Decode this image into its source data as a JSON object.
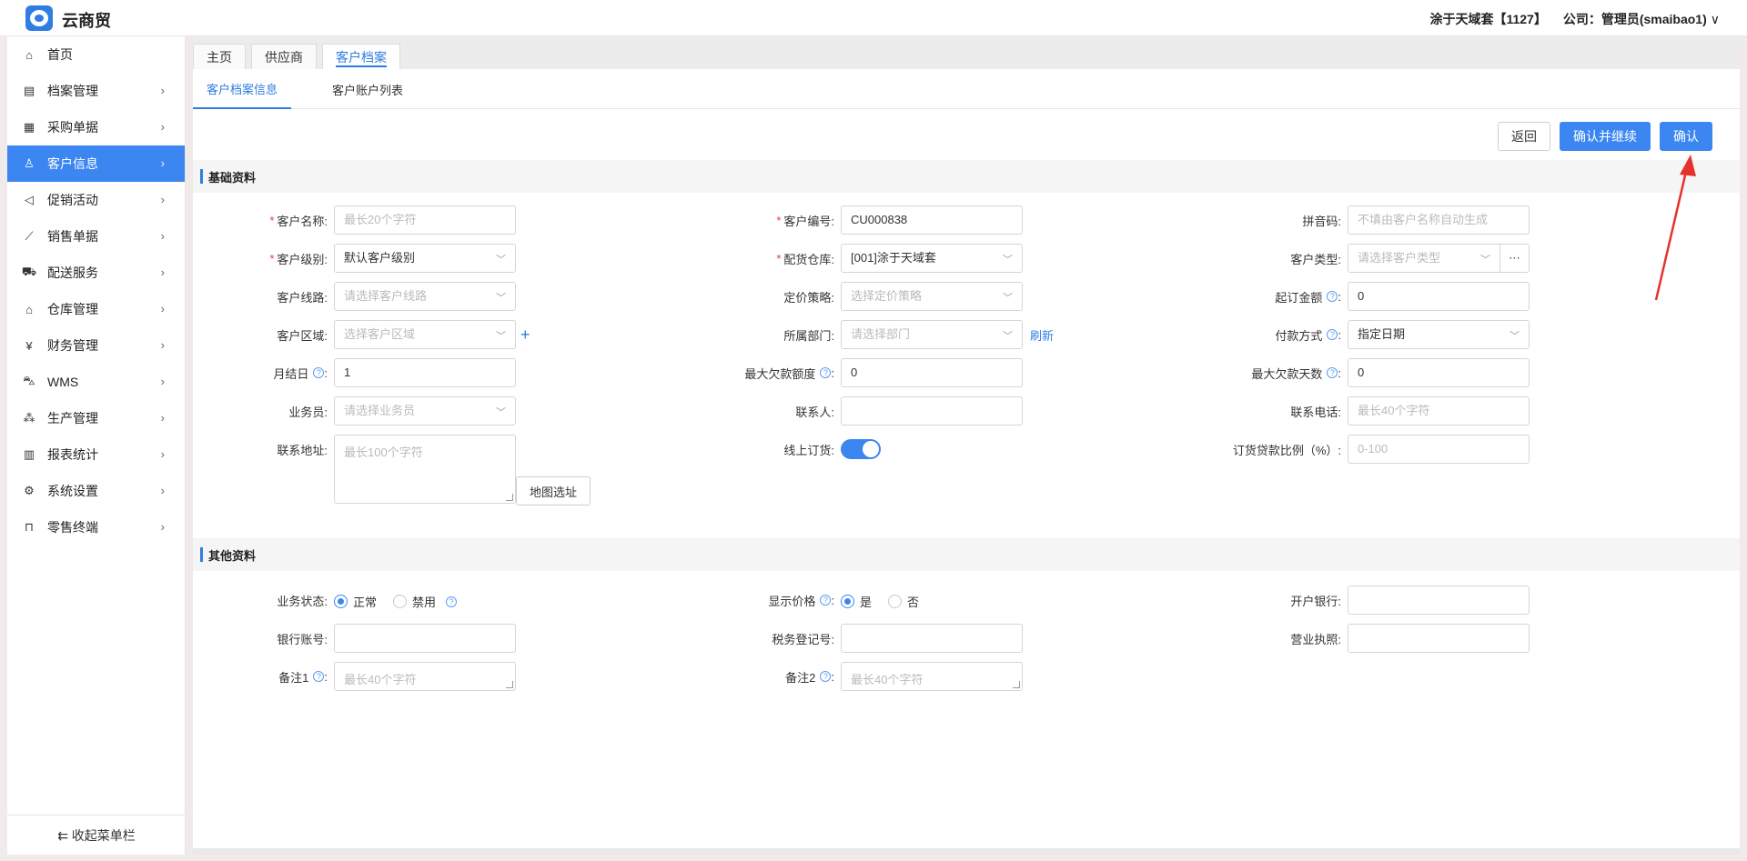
{
  "app": {
    "title": "云商贸"
  },
  "top_right": {
    "store": "涂于天域套【1127】",
    "company": "公司：管理员(smaibao1)"
  },
  "sidebar": {
    "items": [
      {
        "label": "首页",
        "icon": "home-icon",
        "glyph": "⌂"
      },
      {
        "label": "档案管理",
        "icon": "archive-icon",
        "glyph": "▤"
      },
      {
        "label": "采购单据",
        "icon": "purchase-doc-icon",
        "glyph": "▦"
      },
      {
        "label": "客户信息",
        "icon": "user-icon",
        "glyph": "♙"
      },
      {
        "label": "促销活动",
        "icon": "megaphone-icon",
        "glyph": "◁"
      },
      {
        "label": "销售单据",
        "icon": "chart-line-icon",
        "glyph": "⟋"
      },
      {
        "label": "配送服务",
        "icon": "cart-icon",
        "glyph": "⛟"
      },
      {
        "label": "仓库管理",
        "icon": "warehouse-icon",
        "glyph": "⌂"
      },
      {
        "label": "财务管理",
        "icon": "finance-icon",
        "glyph": "¥"
      },
      {
        "label": "WMS",
        "icon": "truck-icon",
        "glyph": "⛍"
      },
      {
        "label": "生产管理",
        "icon": "network-icon",
        "glyph": "⁂"
      },
      {
        "label": "报表统计",
        "icon": "bar-chart-icon",
        "glyph": "▥"
      },
      {
        "label": "系统设置",
        "icon": "gear-icon",
        "glyph": "⚙"
      },
      {
        "label": "零售终端",
        "icon": "bag-icon",
        "glyph": "⊓"
      }
    ],
    "collapse": "⇇ 收起菜单栏"
  },
  "page_tabs": [
    "主页",
    "供应商",
    "客户档案"
  ],
  "sub_tabs": [
    "客户档案信息",
    "客户账户列表"
  ],
  "actions": {
    "back": "返回",
    "confirm_continue": "确认并继续",
    "confirm": "确认"
  },
  "sections": {
    "basic": "基础资料",
    "other": "其他资料"
  },
  "basic": {
    "customer_name": {
      "label": "客户名称:",
      "placeholder": "最长20个字符"
    },
    "customer_code": {
      "label": "客户编号:",
      "value": "CU000838"
    },
    "pinyin": {
      "label": "拼音码:",
      "placeholder": "不填由客户名称自动生成"
    },
    "customer_level": {
      "label": "客户级别:",
      "value": "默认客户级别"
    },
    "warehouse": {
      "label": "配货仓库:",
      "value": "[001]涂于天域套"
    },
    "customer_type": {
      "label": "客户类型:",
      "placeholder": "请选择客户类型"
    },
    "route": {
      "label": "客户线路:",
      "placeholder": "请选择客户线路"
    },
    "pricing": {
      "label": "定价策略:",
      "placeholder": "选择定价策略"
    },
    "min_order": {
      "label": "起订金额",
      "value": "0"
    },
    "region": {
      "label": "客户区域:",
      "placeholder": "选择客户区域"
    },
    "department": {
      "label": "所属部门:",
      "placeholder": "请选择部门",
      "refresh": "刷新"
    },
    "payment": {
      "label": "付款方式",
      "value": "指定日期"
    },
    "statement_day": {
      "label": "月结日",
      "value": "1"
    },
    "max_debt": {
      "label": "最大欠款额度",
      "value": "0"
    },
    "max_debt_days": {
      "label": "最大欠款天数",
      "value": "0"
    },
    "salesman": {
      "label": "业务员:",
      "placeholder": "请选择业务员"
    },
    "contact": {
      "label": "联系人:",
      "value": ""
    },
    "phone": {
      "label": "联系电话:",
      "placeholder": "最长40个字符"
    },
    "address": {
      "label": "联系地址:",
      "placeholder": "最长100个字符",
      "map_btn": "地图选址"
    },
    "online_order": {
      "label": "线上订货:"
    },
    "ratio": {
      "label": "订货贷款比例（%）:",
      "placeholder": "0-100"
    }
  },
  "other": {
    "status": {
      "label": "业务状态:",
      "options": [
        "正常",
        "禁用"
      ],
      "selected": 0
    },
    "show_price": {
      "label": "显示价格",
      "options": [
        "是",
        "否"
      ],
      "selected": 0
    },
    "bank": {
      "label": "开户银行:",
      "value": ""
    },
    "bank_account": {
      "label": "银行账号:",
      "value": ""
    },
    "tax_no": {
      "label": "税务登记号:",
      "value": ""
    },
    "license": {
      "label": "营业执照:",
      "value": ""
    },
    "remark1": {
      "label": "备注1",
      "placeholder": "最长40个字符"
    },
    "remark2": {
      "label": "备注2",
      "placeholder": "最长40个字符"
    }
  },
  "colors": {
    "accent": "#3b86f0",
    "annotation_arrow": "#e5322d"
  }
}
